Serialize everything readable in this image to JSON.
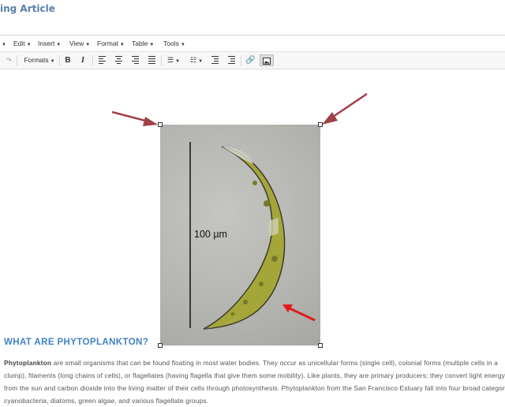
{
  "page": {
    "title": "ing Article"
  },
  "menubar": {
    "items": [
      {
        "label": "Edit"
      },
      {
        "label": "Insert"
      },
      {
        "label": "View"
      },
      {
        "label": "Format"
      },
      {
        "label": "Table"
      },
      {
        "label": "Tools"
      }
    ]
  },
  "toolbar": {
    "formats_label": "Formats",
    "icons": [
      "redo-icon",
      "formats-dropdown",
      "bold-icon",
      "italic-icon",
      "align-left-icon",
      "align-center-icon",
      "align-right-icon",
      "justify-icon",
      "bullet-list-icon",
      "numbered-list-icon",
      "outdent-icon",
      "indent-icon",
      "link-icon",
      "image-icon"
    ],
    "image_button_active": true
  },
  "figure": {
    "scale_label": "100 µm",
    "arrow_color": "#a0414a",
    "highlight_arrow_color": "#e01b1b",
    "icons": [
      "scale-bar",
      "annotation-arrow"
    ]
  },
  "article": {
    "heading": "WHAT ARE PHYTOPLANKTON?",
    "intro_bold": "Phytoplankton",
    "intro_rest": " are small organisms that can be found floating in most water bodies. They occur as unicellular forms (single cell), colonial forms (multiple cells in a clump), filaments (long chains of cells), or flagellates (having flagella that give them some mobility). Like plants, they are primary producers; they convert light energy from the sun and carbon dioxide into the living matter of their cells through photosynthesis. Phytoplankton from the San Francisco Estuary fall into four broad categories: cyanobacteria, diatoms, green algae, and various flagellate groups."
  }
}
